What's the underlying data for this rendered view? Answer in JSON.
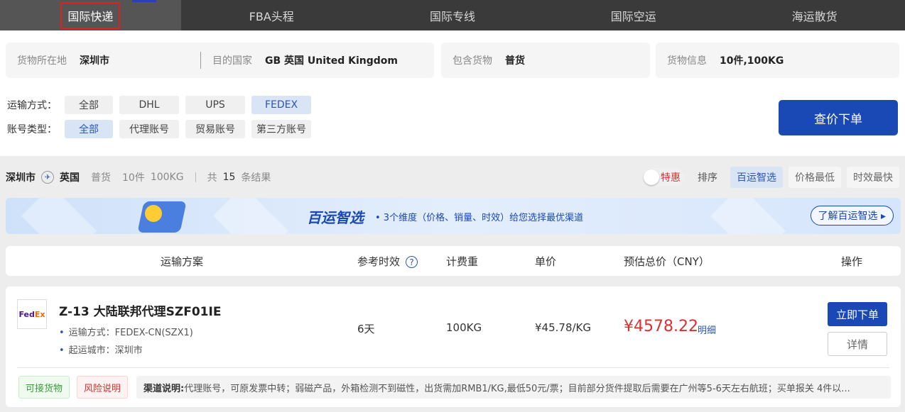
{
  "tabs": [
    {
      "label": "国际快递",
      "active": true
    },
    {
      "label": "FBA头程"
    },
    {
      "label": "国际专线"
    },
    {
      "label": "国际空运"
    },
    {
      "label": "海运散货"
    }
  ],
  "filters": {
    "origin_label": "货物所在地",
    "origin_value": "深圳市",
    "dest_label": "目的国家",
    "dest_value": "GB 英国 United Kingdom",
    "goods_label": "包含货物",
    "goods_value": "普货",
    "cargo_label": "货物信息",
    "cargo_value": "10件,100KG"
  },
  "transport": {
    "label": "运输方式：",
    "options": [
      "全部",
      "DHL",
      "UPS",
      "FEDEX"
    ],
    "selected": "FEDEX"
  },
  "account": {
    "label": "账号类型：",
    "options": [
      "全部",
      "代理账号",
      "贸易账号",
      "第三方账号"
    ],
    "selected": "全部"
  },
  "query_button": "查价下单",
  "summary": {
    "from": "深圳市",
    "to": "英国",
    "goods": "普货",
    "pieces": "10件",
    "weight": "100KG",
    "total_prefix": "共",
    "total": "15",
    "total_suffix": "条结果"
  },
  "sort": {
    "discount_label": "特惠",
    "label": "排序",
    "options": [
      "百运智选",
      "价格最低",
      "时效最快"
    ],
    "selected": "百运智选"
  },
  "banner": {
    "title": "百运智选",
    "desc": "• 3个维度（价格、销量、时效）给您选择最优渠道",
    "learn": "了解百运智选 ▸"
  },
  "table_header": {
    "plan": "运输方案",
    "time": "参考时效",
    "help": "?",
    "weight": "计费重",
    "unit": "单价",
    "total": "预估总价（CNY）",
    "action": "操作"
  },
  "result": {
    "title": "Z-13 大陆联邦代理SZF01IE",
    "mode": "运输方式：FEDEX-CN(SZX1)",
    "city": "起运城市：深圳市",
    "time": "6天",
    "weight": "100KG",
    "unit_price": "¥45.78/KG",
    "total_price": "¥4578.22",
    "detail_link": "明细",
    "order_button": "立即下单",
    "info_button": "详情",
    "tag_ok": "可接货物",
    "tag_risk": "风险说明",
    "note_label": "渠道说明:",
    "note_text": " 代理账号，可原发票中转；弱磁产品，外箱检测不到磁性，出货需加RMB1/KG,最低50元/票；目前部分货件提取后需要在广州等5-6天左右航班；买单报关 4件以..."
  },
  "colors": {
    "brand_blue": "#1a48b4",
    "price_red": "#d93030",
    "dark_bar": "#3a3a3a"
  }
}
